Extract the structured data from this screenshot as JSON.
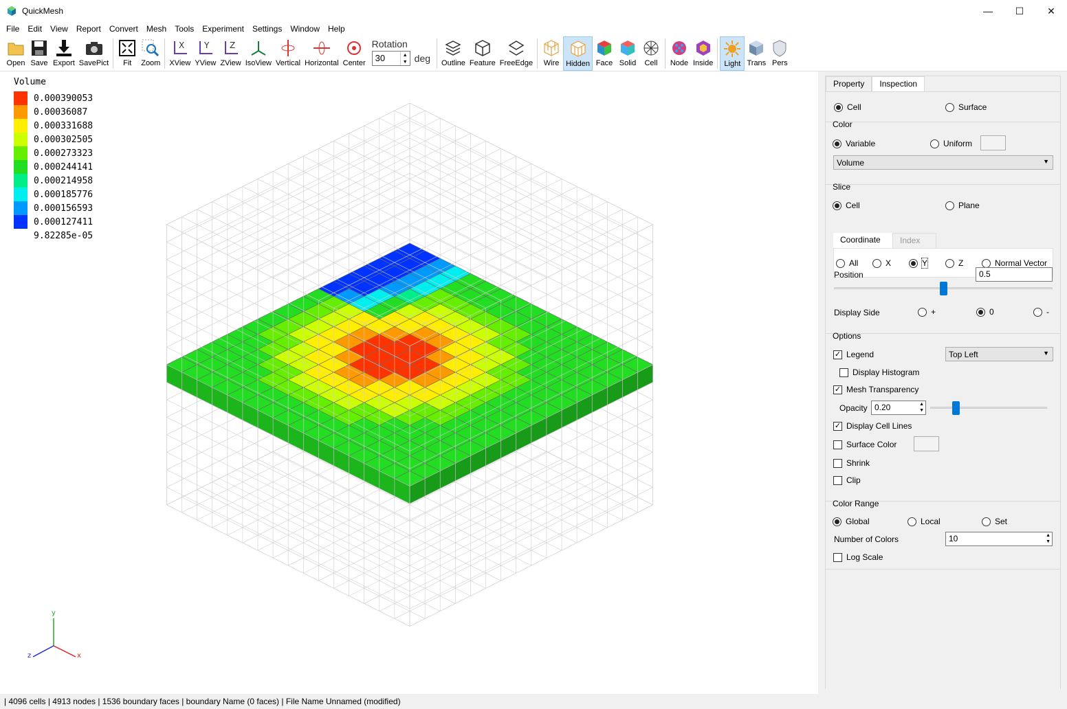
{
  "window": {
    "title": "QuickMesh",
    "minimize": "—",
    "maximize": "☐",
    "close": "✕"
  },
  "menu": [
    "File",
    "Edit",
    "View",
    "Report",
    "Convert",
    "Mesh",
    "Tools",
    "Experiment",
    "Settings",
    "Window",
    "Help"
  ],
  "toolbar": {
    "open": "Open",
    "save": "Save",
    "export": "Export",
    "savepict": "SavePict",
    "fit": "Fit",
    "zoom": "Zoom",
    "xview": "XView",
    "yview": "YView",
    "zview": "ZView",
    "isoview": "IsoView",
    "vertical": "Vertical",
    "horizontal": "Horizontal",
    "center": "Center",
    "rotation_label": "Rotation",
    "rotation_value": "30",
    "rotation_unit": "deg",
    "outline": "Outline",
    "feature": "Feature",
    "freeedge": "FreeEdge",
    "wire": "Wire",
    "hidden": "Hidden",
    "face": "Face",
    "solid": "Solid",
    "cell": "Cell",
    "node": "Node",
    "inside": "Inside",
    "light": "Light",
    "trans": "Trans",
    "pers": "Pers"
  },
  "legend": {
    "title": "Volume",
    "values": [
      "0.000390053",
      "0.00036087",
      "0.000331688",
      "0.000302505",
      "0.000273323",
      "0.000244141",
      "0.000214958",
      "0.000185776",
      "0.000156593",
      "0.000127411",
      "9.82285e-05"
    ],
    "colors": [
      "#ff3300",
      "#ff9900",
      "#ffee00",
      "#ccff00",
      "#66ee00",
      "#22dd22",
      "#00ee88",
      "#00eeee",
      "#0099ff",
      "#0033ff"
    ]
  },
  "axes": {
    "x": "x",
    "y": "y",
    "z": "z"
  },
  "panel": {
    "tabs": [
      "Property",
      "Inspection"
    ],
    "target": {
      "cell": "Cell",
      "surface": "Surface"
    },
    "color": {
      "title": "Color",
      "variable": "Variable",
      "uniform": "Uniform",
      "selected": "Volume"
    },
    "slice": {
      "title": "Slice",
      "cell": "Cell",
      "plane": "Plane",
      "subtabs": [
        "Coordinate",
        "Index"
      ],
      "axes": [
        "All",
        "X",
        "Y",
        "Z",
        "Normal Vector"
      ],
      "position_label": "Position",
      "position_value": "0.5",
      "position_fraction": 0.5,
      "display_side_label": "Display Side",
      "plus": "+",
      "zero": "0",
      "minus": "-"
    },
    "options": {
      "title": "Options",
      "legend": "Legend",
      "legend_pos": "Top Left",
      "histogram": "Display Histogram",
      "transparency": "Mesh Transparency",
      "opacity_label": "Opacity",
      "opacity_value": "0.20",
      "cell_lines": "Display Cell Lines",
      "surface_color": "Surface Color",
      "shrink": "Shrink",
      "clip": "Clip"
    },
    "color_range": {
      "title": "Color Range",
      "global": "Global",
      "local": "Local",
      "set": "Set",
      "num_colors_label": "Number of Colors",
      "num_colors_value": "10",
      "log_scale": "Log Scale"
    }
  },
  "status": "| 4096 cells | 4913 nodes | 1536 boundary faces |  boundary Name  (0 faces) | File Name Unnamed (modified)"
}
